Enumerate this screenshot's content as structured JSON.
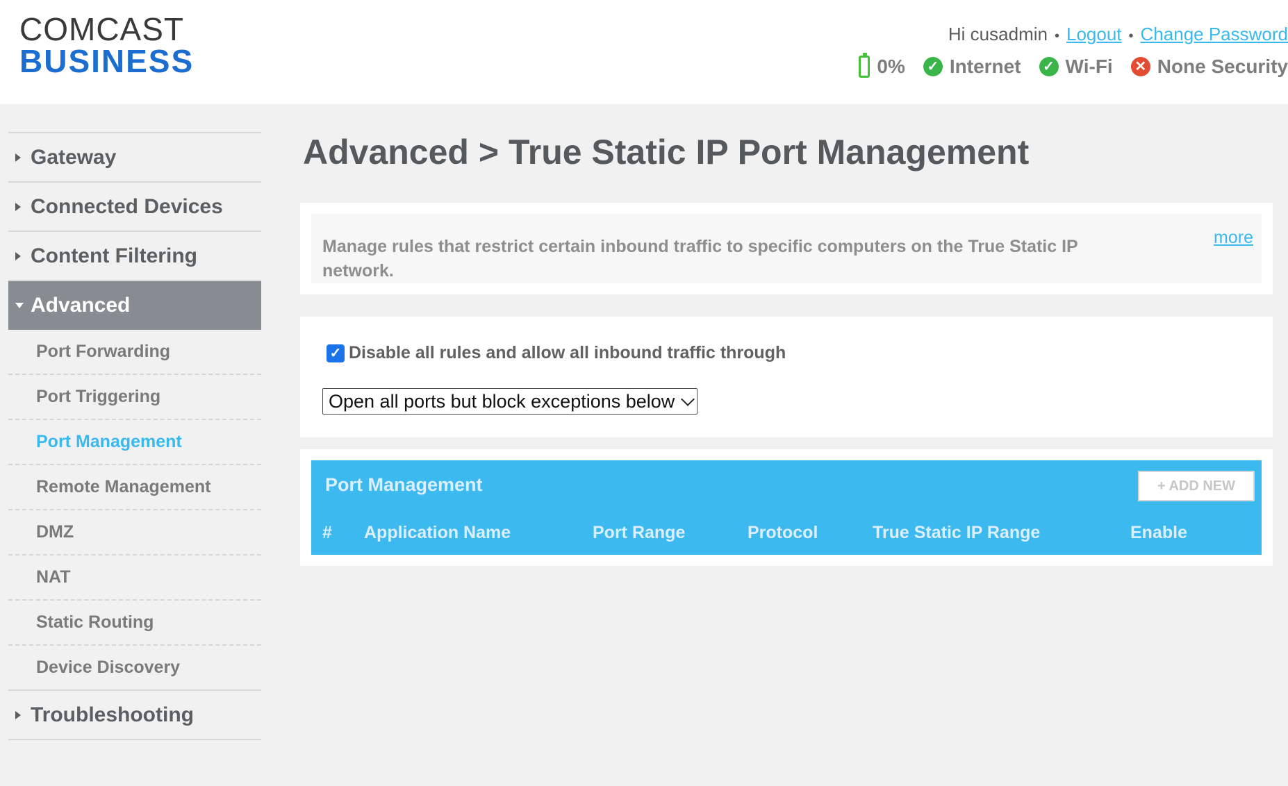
{
  "logo": {
    "line1": "COMCAST",
    "line2": "BUSINESS"
  },
  "user": {
    "greeting": "Hi cusadmin",
    "logout": "Logout",
    "change_password": "Change Password",
    "separator": "•"
  },
  "status": {
    "battery": "0%",
    "internet": "Internet",
    "wifi": "Wi-Fi",
    "security": "None Security"
  },
  "sidebar": {
    "gateway": "Gateway",
    "connected_devices": "Connected Devices",
    "content_filtering": "Content Filtering",
    "advanced": "Advanced",
    "sub": [
      "Port Forwarding",
      "Port Triggering",
      "Port Management",
      "Remote Management",
      "DMZ",
      "NAT",
      "Static Routing",
      "Device Discovery"
    ],
    "troubleshooting": "Troubleshooting"
  },
  "page": {
    "title": "Advanced > True Static IP Port Management"
  },
  "description": {
    "text": "Manage rules that restrict certain inbound traffic to specific computers on the True Static IP network.",
    "more": "more"
  },
  "controls": {
    "disable_label": "Disable all rules and allow all inbound traffic through",
    "disable_checked": true,
    "mode_selected": "Open all ports but block exceptions below"
  },
  "table": {
    "title": "Port Management",
    "add_new": "+ ADD NEW",
    "columns": [
      "#",
      "Application Name",
      "Port Range",
      "Protocol",
      "True Static IP Range",
      "Enable"
    ]
  },
  "colors": {
    "accent": "#3cb9ef",
    "ok": "#3ab54a",
    "bad": "#e34b32",
    "nav_active": "#868c91"
  }
}
